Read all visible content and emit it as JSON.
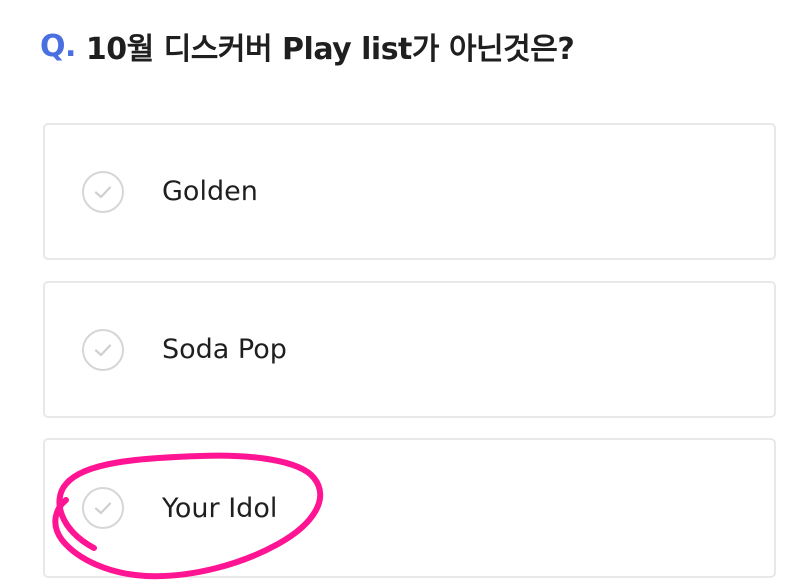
{
  "question": {
    "prefix": "Q.",
    "text": "10월 디스커버 Play list가 아닌것은?"
  },
  "options": [
    {
      "label": "Golden",
      "icon": "check-circle-icon"
    },
    {
      "label": "Soda Pop",
      "icon": "check-circle-icon"
    },
    {
      "label": "Your Idol",
      "icon": "check-circle-icon"
    }
  ],
  "annotation": {
    "color": "#ff1493",
    "marks": "options.2"
  },
  "colors": {
    "accent": "#4a6fe0",
    "border": "#e8e8e8",
    "check": "#d6d6d6",
    "annotation": "#ff1493"
  }
}
